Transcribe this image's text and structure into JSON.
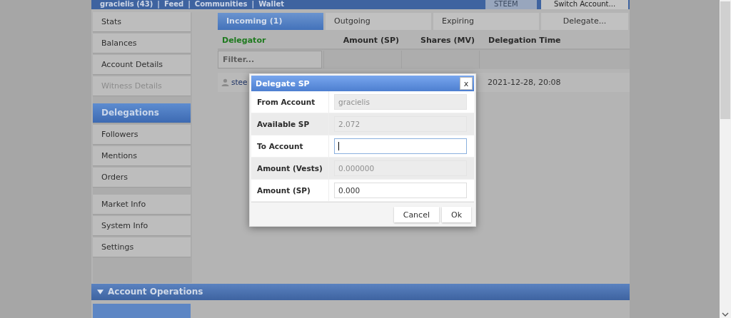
{
  "top_bar": {
    "account": "gracielis (43)",
    "links": [
      {
        "separator": "|",
        "label": "Feed"
      },
      {
        "separator": "|",
        "label": "Communities"
      },
      {
        "separator": "|",
        "label": "Wallet"
      }
    ],
    "currency_select": "STEEM",
    "switch_button": "Switch Account..."
  },
  "sidebar": {
    "groups": [
      [
        {
          "label": "Stats",
          "selected": false,
          "disabled": false
        },
        {
          "label": "Balances",
          "selected": false,
          "disabled": false
        },
        {
          "label": "Account Details",
          "selected": false,
          "disabled": false
        },
        {
          "label": "Witness Details",
          "selected": false,
          "disabled": true
        }
      ],
      [
        {
          "label": "Delegations",
          "selected": true,
          "disabled": false
        },
        {
          "label": "Followers",
          "selected": false,
          "disabled": false
        },
        {
          "label": "Mentions",
          "selected": false,
          "disabled": false
        },
        {
          "label": "Orders",
          "selected": false,
          "disabled": false
        }
      ],
      [
        {
          "label": "Market Info",
          "selected": false,
          "disabled": false
        },
        {
          "label": "System Info",
          "selected": false,
          "disabled": false
        },
        {
          "label": "Settings",
          "selected": false,
          "disabled": false
        }
      ]
    ]
  },
  "tabs": [
    {
      "label": "Incoming (1)",
      "selected": true
    },
    {
      "label": "Outgoing",
      "selected": false
    },
    {
      "label": "Expiring",
      "selected": false
    },
    {
      "label": "Delegate...",
      "selected": false
    }
  ],
  "table": {
    "columns": [
      {
        "label": "Delegator",
        "sorted": true
      },
      {
        "label": "Amount (SP)",
        "sorted": false
      },
      {
        "label": "Shares (MV)",
        "sorted": false
      },
      {
        "label": "Delegation Time",
        "sorted": false
      }
    ],
    "filter_placeholder": "Filter...",
    "rows": [
      {
        "delegator": "stee",
        "delegation_time": "2021-12-28, 20:08"
      }
    ]
  },
  "dialog": {
    "title": "Delegate SP",
    "close": "x",
    "fields": [
      {
        "label": "From Account",
        "value": "gracielis",
        "disabled": true,
        "focused": false
      },
      {
        "label": "Available SP",
        "value": "2.072",
        "disabled": true,
        "focused": false
      },
      {
        "label": "To Account",
        "disabled": false,
        "focused": true
      },
      {
        "label": "Amount (Vests)",
        "value": "0.000000",
        "disabled": true,
        "focused": false
      },
      {
        "label": "Amount (SP)",
        "value": "0.000",
        "disabled": false,
        "focused": false
      }
    ],
    "buttons": [
      "Cancel",
      "Ok"
    ]
  },
  "section_bar": {
    "title": "Account Operations",
    "expanded": true
  }
}
